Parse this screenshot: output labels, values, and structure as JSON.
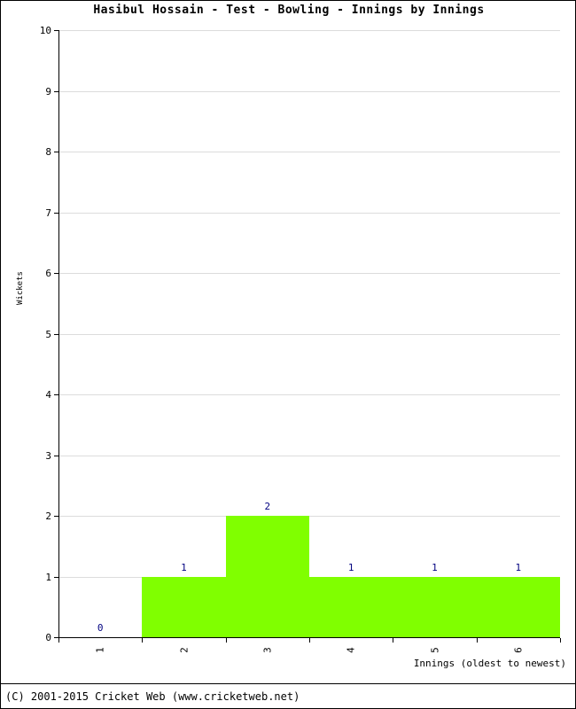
{
  "chart_data": {
    "type": "bar",
    "title": "Hasibul Hossain - Test - Bowling - Innings by Innings",
    "xlabel": "Innings (oldest to newest)",
    "ylabel": "Wickets",
    "categories": [
      "1",
      "2",
      "3",
      "4",
      "5",
      "6"
    ],
    "values": [
      0,
      1,
      2,
      1,
      1,
      1
    ],
    "data_labels": [
      "0",
      "1",
      "2",
      "1",
      "1",
      "1"
    ],
    "ylim": [
      0,
      10
    ],
    "ytick_labels": [
      "0",
      "1",
      "2",
      "3",
      "4",
      "5",
      "6",
      "7",
      "8",
      "9",
      "10"
    ],
    "grid": true,
    "legend": false,
    "series": [
      {
        "name": "Wickets",
        "values": [
          0,
          1,
          2,
          1,
          1,
          1
        ]
      }
    ],
    "colors": {
      "bar_fill": "#80FF00",
      "data_label": "#000080",
      "gridline": "#DCDCDC",
      "axis": "#000000",
      "background": "#FFFFFF"
    }
  },
  "footer": {
    "copyright": "(C) 2001-2015 Cricket Web (www.cricketweb.net)"
  }
}
